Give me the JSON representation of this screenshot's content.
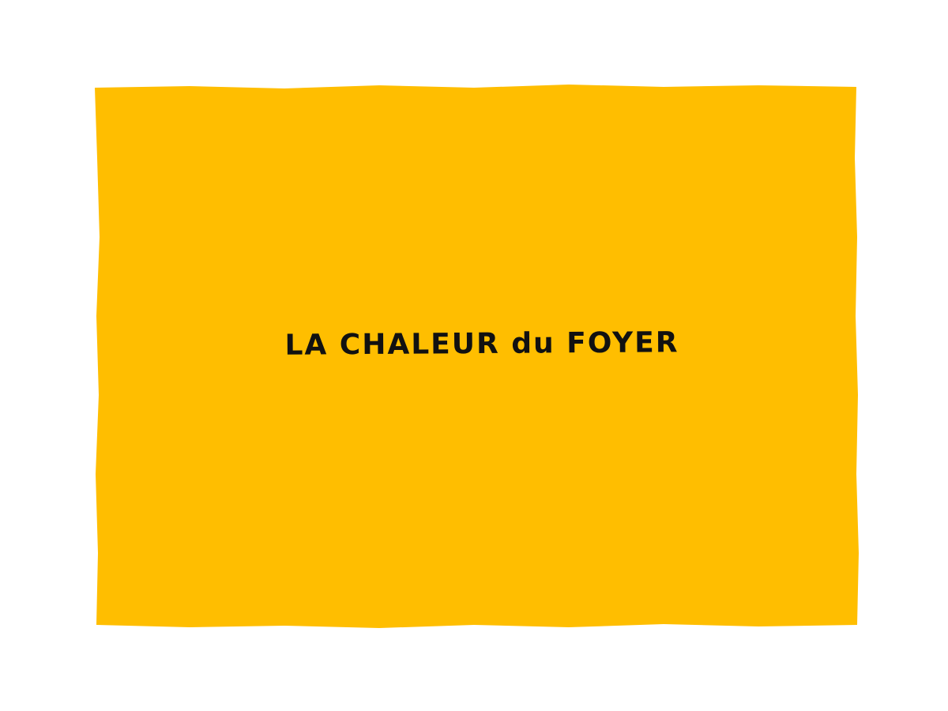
{
  "colors": {
    "background": "#FFFFFF",
    "panel": "#FFBE00",
    "text": "#111111"
  },
  "title": "LA CHALEUR du FOYER"
}
